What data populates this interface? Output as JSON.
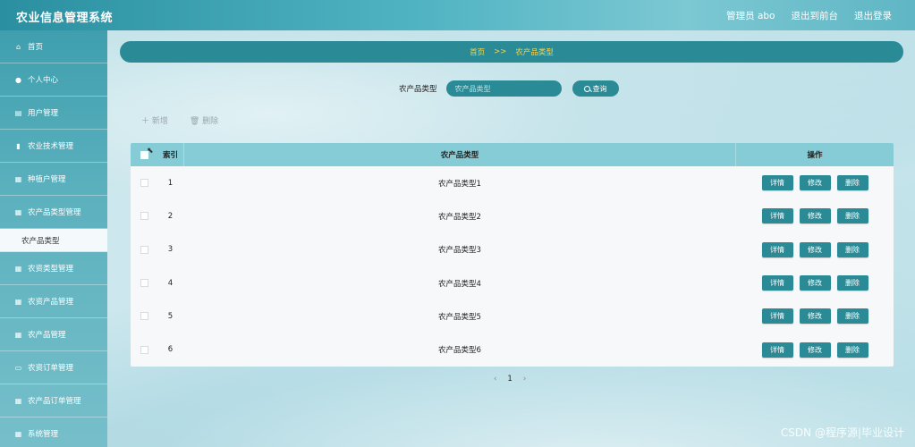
{
  "app": {
    "title": "农业信息管理系统"
  },
  "top_links": [
    "管理员 abo",
    "退出到前台",
    "退出登录"
  ],
  "sidebar": {
    "items": [
      {
        "label": "首页",
        "icon": "home-icon",
        "glyph": "⌂"
      },
      {
        "label": "个人中心",
        "icon": "user-icon",
        "glyph": "●"
      },
      {
        "label": "用户管理",
        "icon": "database-icon",
        "glyph": "▤"
      },
      {
        "label": "农业技术管理",
        "icon": "bar-chart-icon",
        "glyph": "▮"
      },
      {
        "label": "种植户管理",
        "icon": "grid-icon",
        "glyph": "▦"
      },
      {
        "label": "农产品类型管理",
        "icon": "grid-icon",
        "glyph": "▦"
      }
    ],
    "active_sub": "农产品类型",
    "items_after": [
      {
        "label": "农资类型管理",
        "icon": "grid-icon",
        "glyph": "▦"
      },
      {
        "label": "农资产品管理",
        "icon": "grid-icon",
        "glyph": "▦"
      },
      {
        "label": "农产品管理",
        "icon": "grid-icon",
        "glyph": "▦"
      },
      {
        "label": "农资订单管理",
        "icon": "monitor-icon",
        "glyph": "▭"
      },
      {
        "label": "农产品订单管理",
        "icon": "grid-icon",
        "glyph": "▦"
      },
      {
        "label": "系统管理",
        "icon": "grid-icon",
        "glyph": "▦"
      }
    ]
  },
  "breadcrumb": {
    "home": "首页",
    "sep": ">>",
    "current": "农产品类型"
  },
  "search": {
    "label": "农产品类型",
    "placeholder": "农产品类型",
    "button": "查询"
  },
  "actions": {
    "add": "＋ 新增",
    "delete": "🗑 删除"
  },
  "table": {
    "headers": {
      "index": "索引",
      "name": "农产品类型",
      "ops": "操作"
    },
    "rows": [
      {
        "index": "1",
        "name": "农产品类型1"
      },
      {
        "index": "2",
        "name": "农产品类型2"
      },
      {
        "index": "3",
        "name": "农产品类型3"
      },
      {
        "index": "4",
        "name": "农产品类型4"
      },
      {
        "index": "5",
        "name": "农产品类型5"
      },
      {
        "index": "6",
        "name": "农产品类型6"
      }
    ],
    "op_labels": {
      "detail": "详情",
      "edit": "修改",
      "delete": "删除"
    }
  },
  "pager": {
    "prev": "‹",
    "current": "1",
    "next": "›"
  },
  "watermark": "CSDN @程序源|毕业设计",
  "colors": {
    "primary": "#2a8b97",
    "breadcrumb_text": "#f5d44a",
    "header_row": "#86ccd7"
  }
}
